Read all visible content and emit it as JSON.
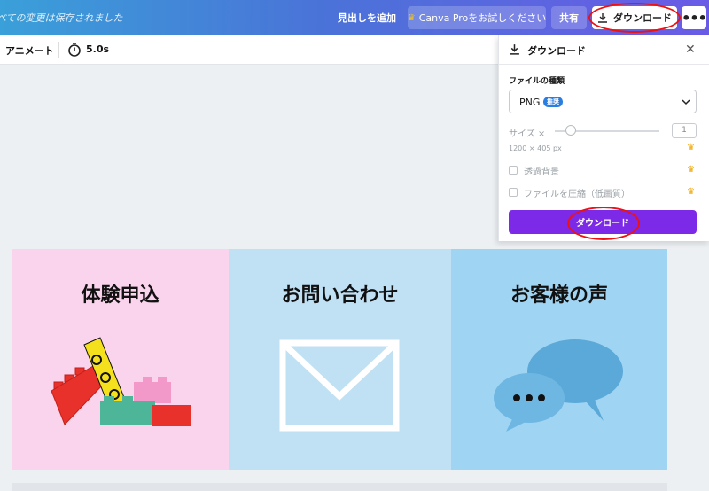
{
  "topbar": {
    "save_status": "べての変更は保存されました",
    "add_heading_label": "見出しを追加",
    "try_pro_label": "Canva Proをお試しください",
    "share_label": "共有",
    "download_label": "ダウンロード",
    "more_label": "•••"
  },
  "subbar": {
    "animate_label": "アニメート",
    "duration": "5.0s"
  },
  "download_panel": {
    "title": "ダウンロード",
    "close_glyph": "✕",
    "file_type_label": "ファイルの種類",
    "file_type_value": "PNG",
    "recommended_badge": "推奨",
    "size_label": "サイズ ×",
    "size_value": "1",
    "size_fraction": 0.15,
    "dimensions": "1200 × 405 px",
    "transparent_bg_label": "透過背景",
    "compress_label": "ファイルを圧縮（低画質）",
    "download_button": "ダウンロード",
    "crown_glyph": "♛"
  },
  "design": {
    "cards": [
      {
        "title": "体験申込",
        "bg": "#f9d4ec",
        "art": "lego-blocks-illustration"
      },
      {
        "title": "お問い合わせ",
        "bg": "#c0e0f4",
        "art": "envelope-icon"
      },
      {
        "title": "お客様の声",
        "bg": "#a0d4f3",
        "art": "speech-bubbles-icon"
      }
    ]
  },
  "colors": {
    "topbar_gradient_start": "#3aa0d9",
    "topbar_gradient_end": "#6a5be6",
    "download_button": "#7d2ae8",
    "annotation_red": "#e11111",
    "badge_blue": "#2a7de1"
  }
}
